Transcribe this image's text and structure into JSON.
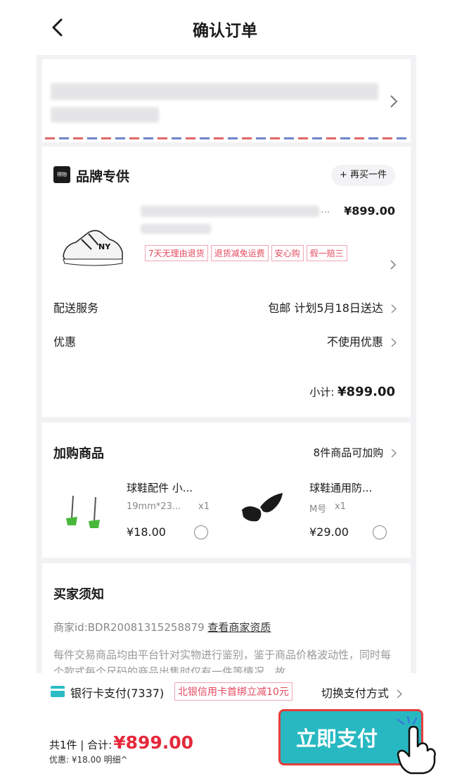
{
  "header": {
    "title": "确认订单"
  },
  "product": {
    "brand": "品牌专供",
    "brand_logo_text": "得物",
    "rebuy_label": "+ 再买一件",
    "ellipsis": "...",
    "price": "¥899.00",
    "tags": [
      "7天无理由退货",
      "退货减免运费",
      "安心购",
      "假一赔三"
    ],
    "delivery_label": "配送服务",
    "delivery_value": "包邮 计划5月18日送达",
    "coupon_label": "优惠",
    "coupon_value": "不使用优惠",
    "subtotal_label": "小计: ",
    "subtotal_value": "¥899.00"
  },
  "addons": {
    "title": "加购商品",
    "more": "8件商品可加购",
    "items": [
      {
        "name": "球鞋配件 小...",
        "spec": "19mm*23...",
        "qty": "x1",
        "price": "¥18.00"
      },
      {
        "name": "球鞋通用防...",
        "spec": "M号",
        "qty": "x1",
        "price": "¥29.00"
      }
    ]
  },
  "notice": {
    "title": "买家须知",
    "merchant_prefix": "商家id:BDR20081315258879",
    "merchant_link": "查看商家资质",
    "text": "每件交易商品均由平台针对实物进行鉴别，鉴于商品价格波动性，同时每个款式每个尺码的商品出售时仅有一件等情况，故"
  },
  "payment": {
    "method": "银行卡支付(7337)",
    "promo": "北银信用卡首绑立减10元",
    "switch": "切换支付方式"
  },
  "footer": {
    "total_prefix": "共1件 | 合计:",
    "total_amount": "¥899.00",
    "discount": "优惠: ¥18.00 明细^",
    "pay_button": "立即支付"
  },
  "colors": {
    "accent": "#e4293b",
    "pay_button": "#28b8c2",
    "tag_border": "#f0a6b1"
  }
}
